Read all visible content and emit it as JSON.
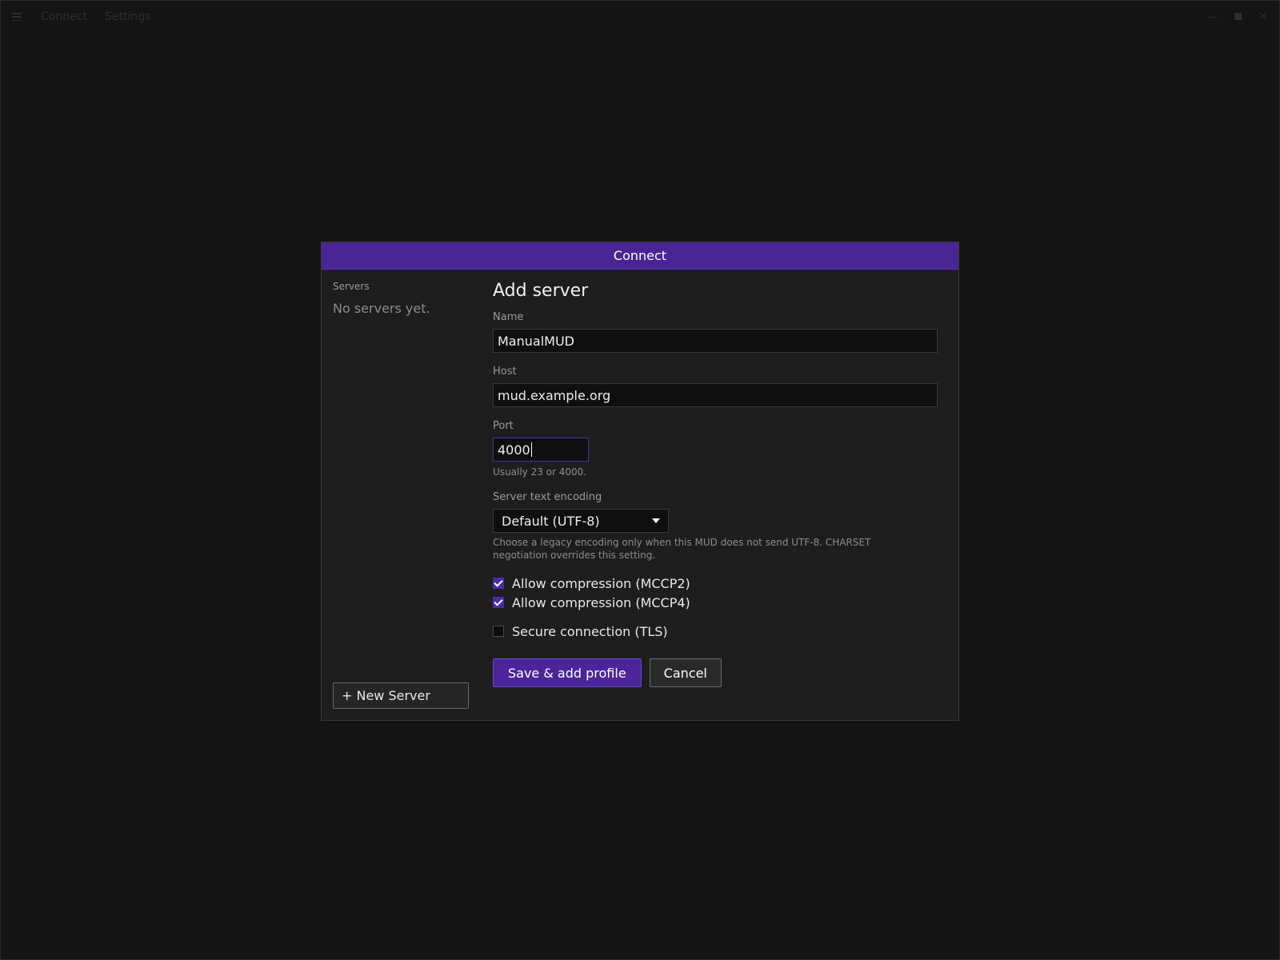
{
  "menubar": {
    "items": [
      "Connect",
      "Settings"
    ]
  },
  "dialog": {
    "title": "Connect",
    "sidebar": {
      "title": "Servers",
      "empty_text": "No servers yet.",
      "new_server_label": "+ New Server"
    },
    "form": {
      "title": "Add server",
      "name": {
        "label": "Name",
        "value": "ManualMUD"
      },
      "host": {
        "label": "Host",
        "value": "mud.example.org"
      },
      "port": {
        "label": "Port",
        "value": "4000",
        "help": "Usually 23 or 4000."
      },
      "encoding": {
        "label": "Server text encoding",
        "selected": "Default (UTF-8)",
        "help": "Choose a legacy encoding only when this MUD does not send UTF-8. CHARSET negotiation overrides this setting."
      },
      "options": [
        {
          "label": "Allow compression (MCCP2)",
          "checked": true
        },
        {
          "label": "Allow compression (MCCP4)",
          "checked": true
        },
        {
          "label": "Secure connection (TLS)",
          "checked": false
        }
      ],
      "save_label": "Save & add profile",
      "cancel_label": "Cancel"
    }
  },
  "colors": {
    "accent": "#4a2596",
    "background": "#141414",
    "dialog_bg": "#1e1e1e"
  }
}
